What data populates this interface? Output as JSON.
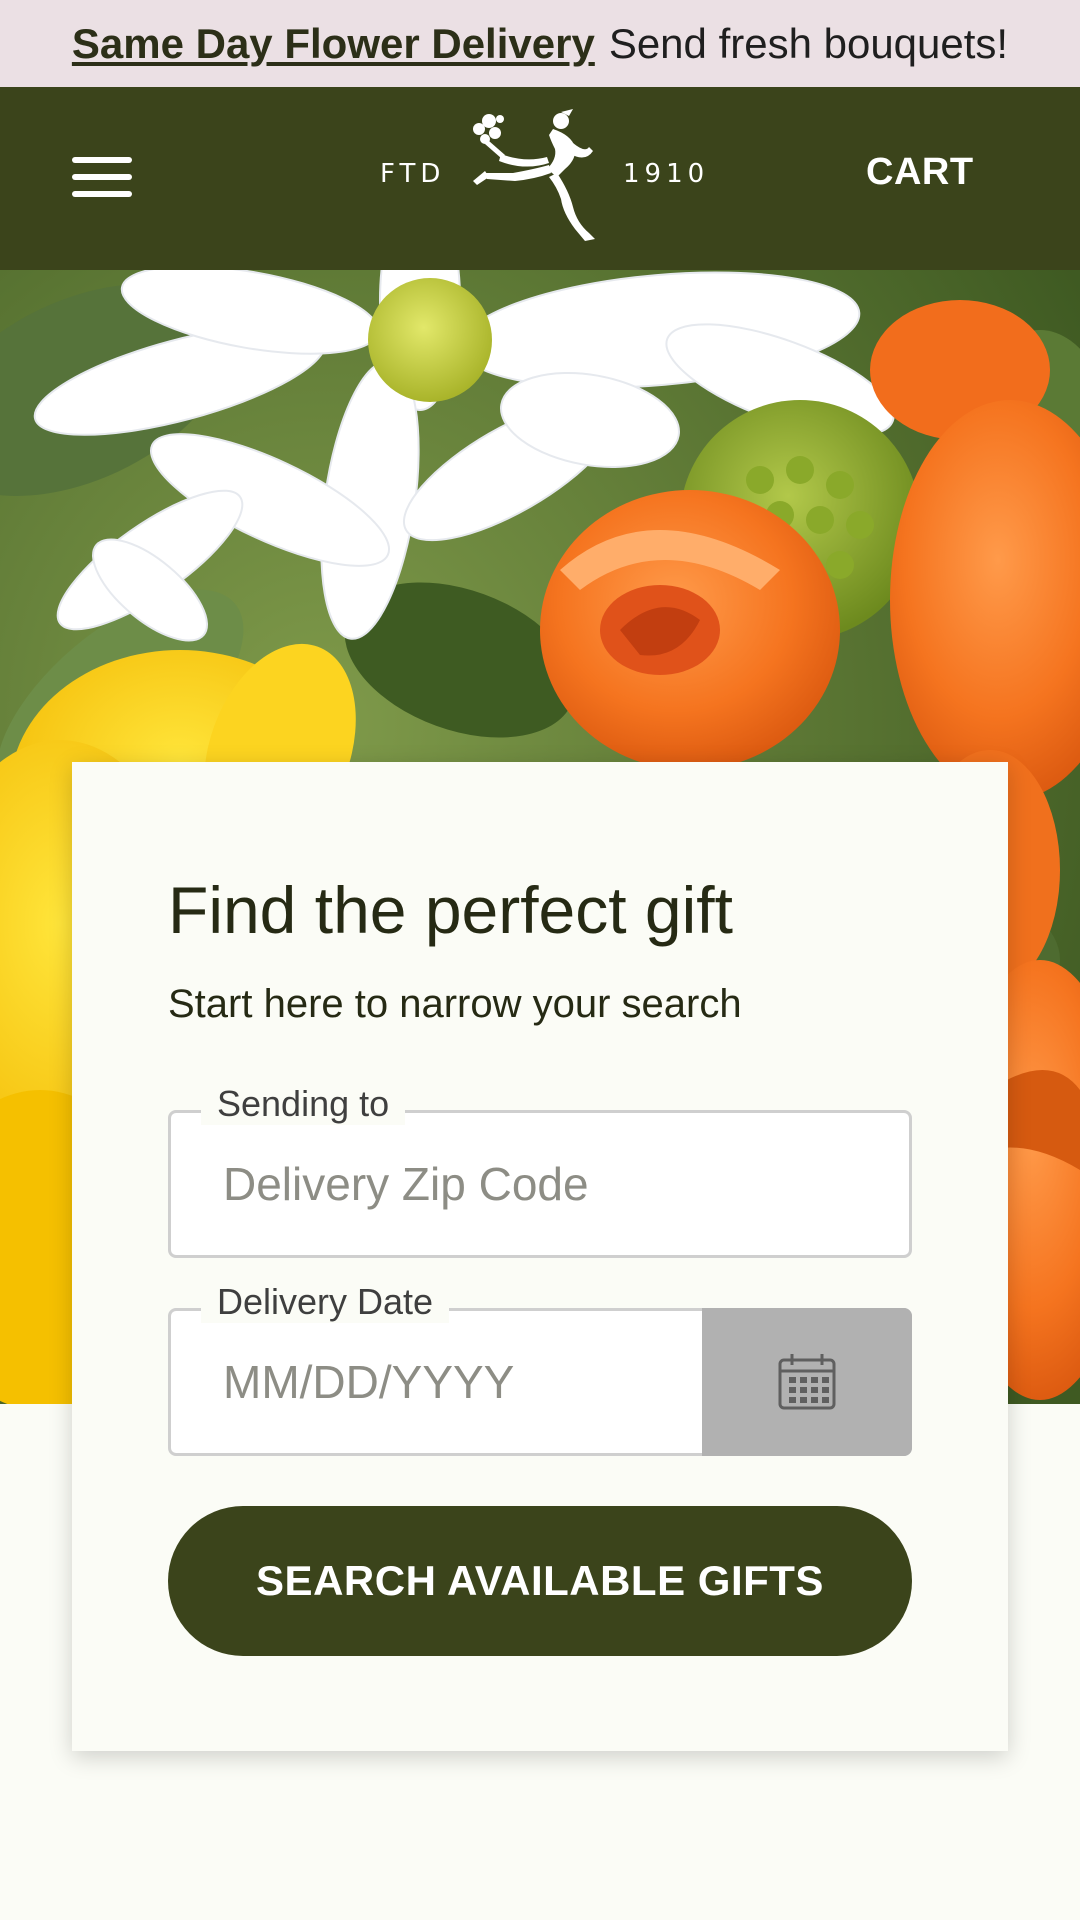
{
  "promo": {
    "link_text": "Same Day Flower Delivery",
    "tagline": "Send fresh bouquets!"
  },
  "header": {
    "menu_icon": "hamburger-menu-icon",
    "logo": {
      "left_text": "FTD",
      "right_text": "1910",
      "emblem_icon": "mercury-man-logo"
    },
    "cart_label": "CART"
  },
  "hero": {
    "image": "bouquet-daisies-orange-roses-yellow-flowers"
  },
  "search_card": {
    "title": "Find the perfect gift",
    "subtitle": "Start here to narrow your search",
    "zip_field": {
      "label": "Sending to",
      "placeholder": "Delivery Zip Code",
      "value": ""
    },
    "date_field": {
      "label": "Delivery Date",
      "placeholder": "MM/DD/YYYY",
      "value": "",
      "calendar_icon": "calendar-icon"
    },
    "submit_label": "SEARCH AVAILABLE GIFTS"
  },
  "colors": {
    "brand_dark_green": "#3b441b",
    "promo_background": "#ebe0e4",
    "page_background": "#fbfcf6",
    "calendar_button": "#b1b1b1"
  }
}
